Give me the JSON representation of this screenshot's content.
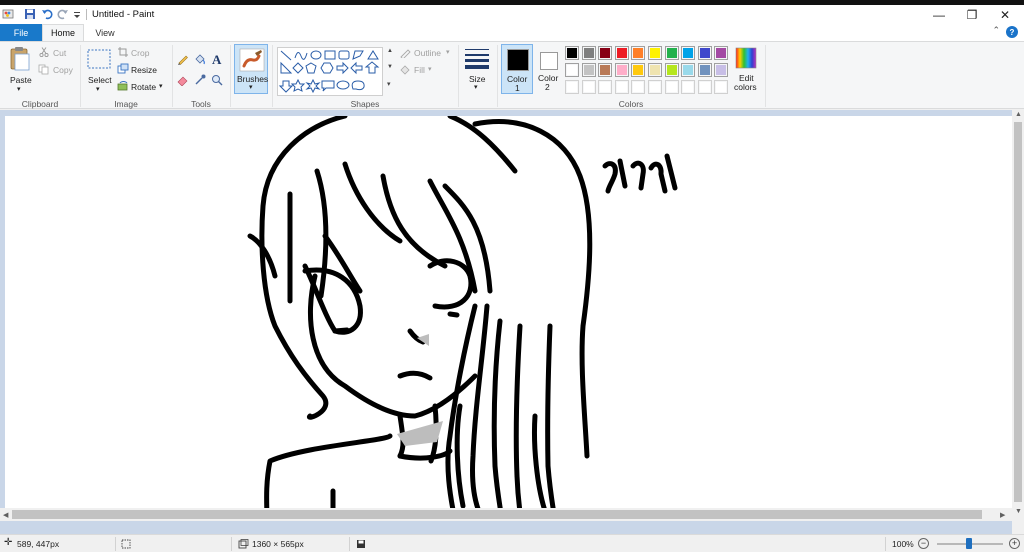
{
  "window": {
    "title": "Untitled - Paint",
    "minimize_glyph": "—",
    "maximize_glyph": "❐",
    "close_glyph": "✕"
  },
  "tabs": [
    {
      "label": "File"
    },
    {
      "label": "Home"
    },
    {
      "label": "View"
    }
  ],
  "ribbon": {
    "clipboard": {
      "label": "Clipboard",
      "paste": "Paste",
      "cut": "Cut",
      "copy": "Copy"
    },
    "image": {
      "label": "Image",
      "select": "Select",
      "crop": "Crop",
      "resize": "Resize",
      "rotate": "Rotate"
    },
    "tools": {
      "label": "Tools"
    },
    "brushes": {
      "label": "Brushes"
    },
    "shapes": {
      "label": "Shapes",
      "outline": "Outline",
      "fill": "Fill"
    },
    "size": {
      "label": "Size"
    },
    "colors": {
      "label": "Colors",
      "color1_label": "Color",
      "color1_num": "1",
      "color2_label": "Color",
      "color2_num": "2",
      "color1_value": "#000000",
      "color2_value": "#ffffff",
      "edit_colors_line1": "Edit",
      "edit_colors_line2": "colors",
      "palette_row1": [
        "#000000",
        "#7f7f7f",
        "#880015",
        "#ed1c24",
        "#ff7f27",
        "#fff200",
        "#22b14c",
        "#00a2e8",
        "#3f48cc",
        "#a349a4"
      ],
      "palette_row2": [
        "#ffffff",
        "#c3c3c3",
        "#b97a57",
        "#ffaec9",
        "#ffc90e",
        "#efe4b0",
        "#b5e61d",
        "#99d9ea",
        "#7092be",
        "#c8bfe7"
      ],
      "palette_row3": [
        "#ffffff",
        "#ffffff",
        "#ffffff",
        "#ffffff",
        "#ffffff",
        "#ffffff",
        "#ffffff",
        "#ffffff",
        "#ffffff",
        "#ffffff"
      ]
    }
  },
  "status": {
    "cursor_pos": "589, 447px",
    "image_size": "1360 × 565px",
    "zoom": "100%"
  },
  "accent": "#1979ca"
}
